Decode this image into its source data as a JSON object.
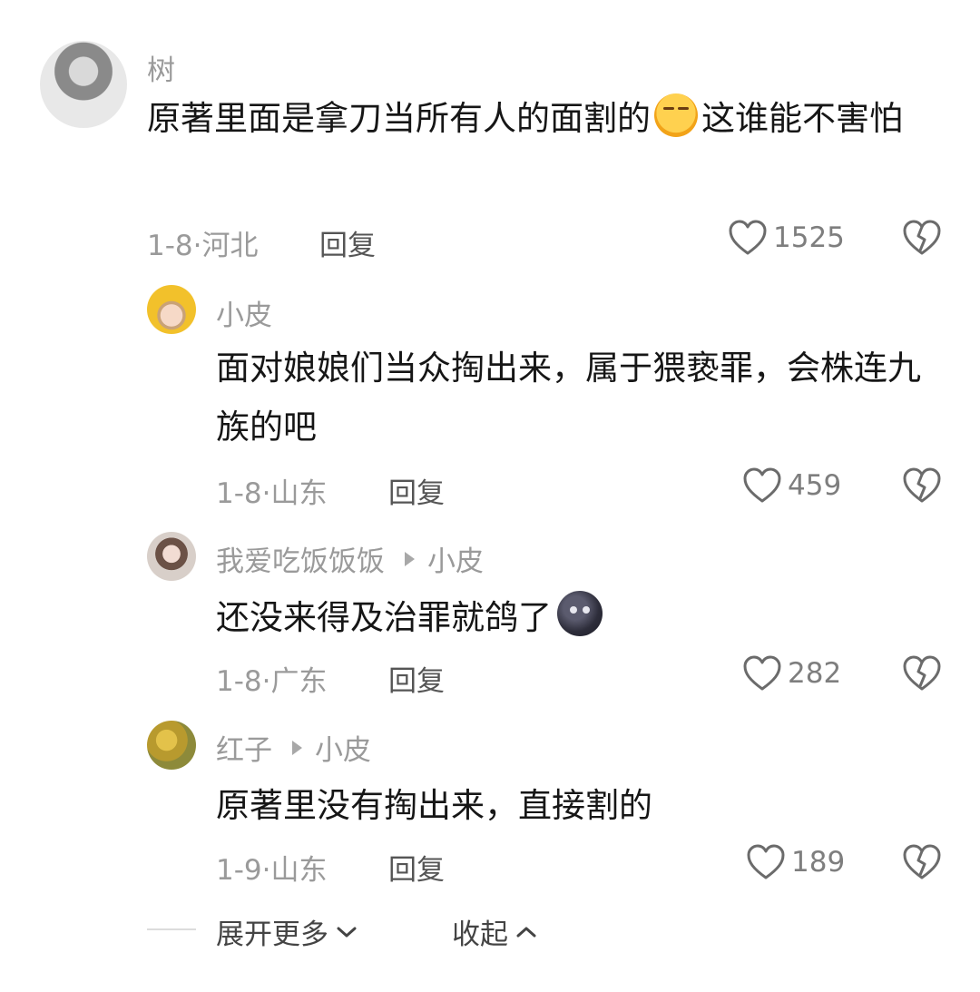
{
  "comments": [
    {
      "user": "树",
      "text_before_emoji": "原著里面是拿刀当所有人的面割的",
      "emoji": "blushing-face-emoji",
      "text_after_emoji": "这谁能不害怕",
      "date": "1-8",
      "location": "河北",
      "reply_label": "回复",
      "likes": "1525"
    },
    {
      "user": "小皮",
      "text": "面对娘娘们当众掏出来，属于猥亵罪，会株连九族的吧",
      "date": "1-8",
      "location": "山东",
      "reply_label": "回复",
      "likes": "459"
    },
    {
      "user": "我爱吃饭饭饭",
      "reply_to": "小皮",
      "text": "还没来得及治罪就鸽了",
      "emoji": "new-moon-face-emoji",
      "date": "1-8",
      "location": "广东",
      "reply_label": "回复",
      "likes": "282"
    },
    {
      "user": "红子",
      "reply_to": "小皮",
      "text": "原著里没有掏出来，直接割的",
      "date": "1-9",
      "location": "山东",
      "reply_label": "回复",
      "likes": "189"
    }
  ],
  "footer": {
    "expand_label": "展开更多",
    "collapse_label": "收起"
  },
  "icons": [
    "heart-outline-icon",
    "broken-heart-icon",
    "chevron-down-icon",
    "chevron-up-icon",
    "play-triangle-icon"
  ]
}
